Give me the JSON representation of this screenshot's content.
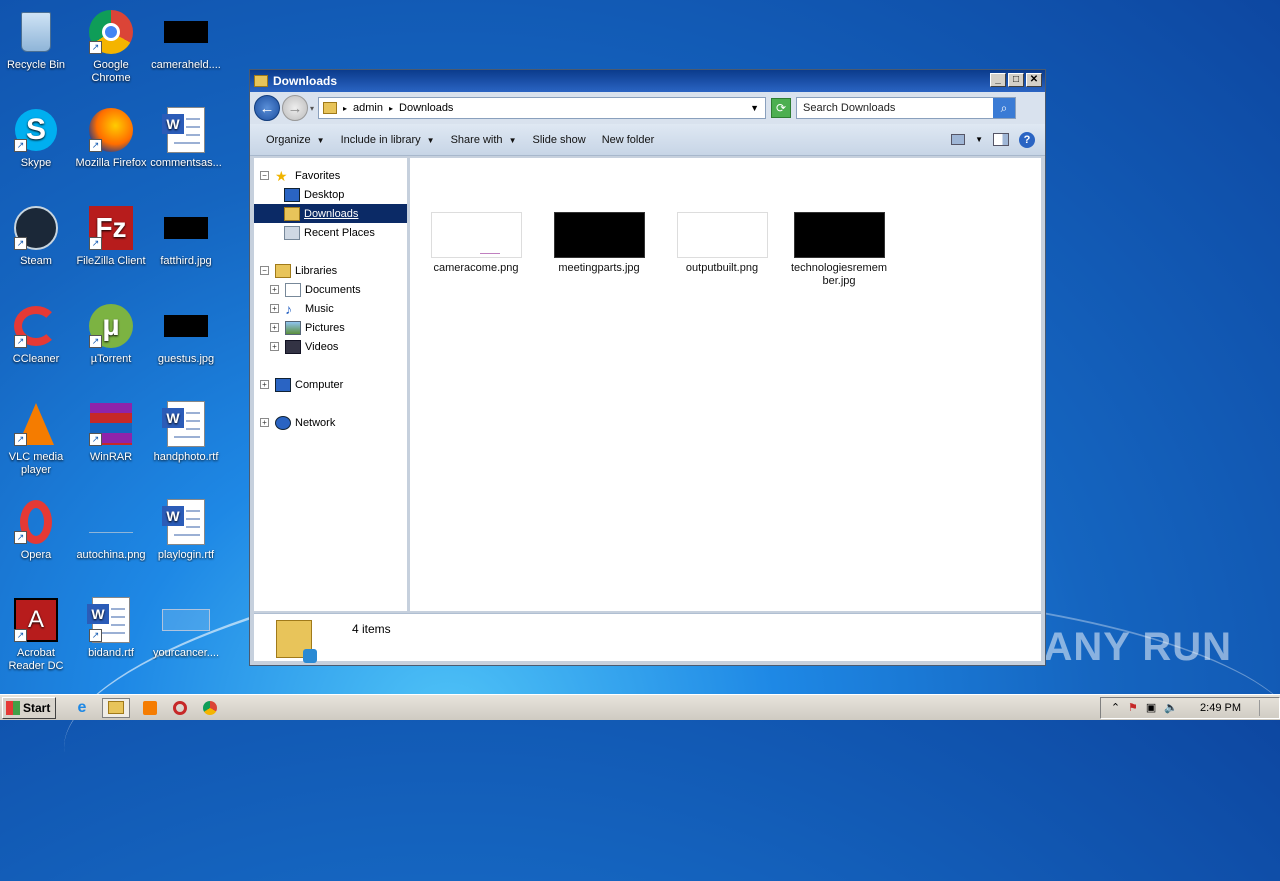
{
  "desktop": {
    "icons": [
      {
        "label": "Recycle Bin"
      },
      {
        "label": "Google Chrome"
      },
      {
        "label": "cameraheld...."
      },
      {
        "label": "Skype"
      },
      {
        "label": "Mozilla Firefox"
      },
      {
        "label": "commentsas..."
      },
      {
        "label": "Steam"
      },
      {
        "label": "FileZilla Client"
      },
      {
        "label": "fatthird.jpg"
      },
      {
        "label": "CCleaner"
      },
      {
        "label": "µTorrent"
      },
      {
        "label": "guestus.jpg"
      },
      {
        "label": "VLC media player"
      },
      {
        "label": "WinRAR"
      },
      {
        "label": "handphoto.rtf"
      },
      {
        "label": "Opera"
      },
      {
        "label": "autochina.png"
      },
      {
        "label": "playlogin.rtf"
      },
      {
        "label": "Acrobat Reader DC"
      },
      {
        "label": "bidand.rtf"
      },
      {
        "label": "yourcancer...."
      }
    ],
    "watermark": "ANY RUN"
  },
  "window": {
    "title": "Downloads",
    "address": {
      "crumb1": "admin",
      "crumb2": "Downloads"
    },
    "search_placeholder": "Search Downloads",
    "toolbar": {
      "organize": "Organize",
      "include": "Include in library",
      "share": "Share with",
      "slideshow": "Slide show",
      "newfolder": "New folder"
    },
    "nav": {
      "favorites": "Favorites",
      "desktop": "Desktop",
      "downloads": "Downloads",
      "recent": "Recent Places",
      "libraries": "Libraries",
      "documents": "Documents",
      "music": "Music",
      "pictures": "Pictures",
      "videos": "Videos",
      "computer": "Computer",
      "network": "Network"
    },
    "files": [
      {
        "name": "cameracome.png",
        "thumb": "light"
      },
      {
        "name": "meetingparts.jpg",
        "thumb": "dark"
      },
      {
        "name": "outputbuilt.png",
        "thumb": "light"
      },
      {
        "name": "technologiesremember.jpg",
        "thumb": "dark"
      }
    ],
    "status": "4 items"
  },
  "taskbar": {
    "start": "Start",
    "clock": "2:49 PM"
  }
}
